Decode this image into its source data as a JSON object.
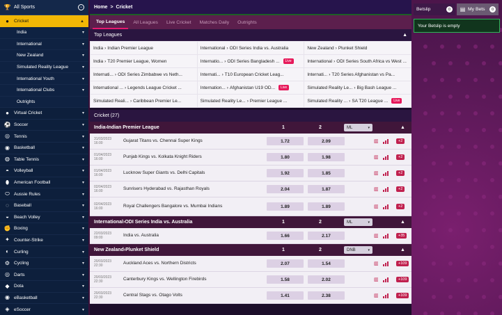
{
  "sidebar": {
    "all_sports": "All Sports",
    "cricket": "Cricket",
    "cricket_sub": [
      "India",
      "International",
      "New Zealand",
      "Simulated Reality League",
      "International Youth",
      "International Clubs",
      "Outrights"
    ],
    "sports": [
      {
        "label": "Virtual Cricket",
        "icon": "cricket-ball-icon"
      },
      {
        "label": "Soccer",
        "icon": "soccer-icon"
      },
      {
        "label": "Tennis",
        "icon": "tennis-icon"
      },
      {
        "label": "Basketball",
        "icon": "basketball-icon"
      },
      {
        "label": "Table Tennis",
        "icon": "table-tennis-icon"
      },
      {
        "label": "Volleyball",
        "icon": "volleyball-icon"
      },
      {
        "label": "American Football",
        "icon": "american-football-icon"
      },
      {
        "label": "Aussie Rules",
        "icon": "aussie-rules-icon"
      },
      {
        "label": "Baseball",
        "icon": "baseball-icon"
      },
      {
        "label": "Beach Volley",
        "icon": "beach-volley-icon"
      },
      {
        "label": "Boxing",
        "icon": "boxing-icon"
      },
      {
        "label": "Counter-Strike",
        "icon": "counter-strike-icon"
      },
      {
        "label": "Curling",
        "icon": "curling-icon"
      },
      {
        "label": "Cycling",
        "icon": "cycling-icon"
      },
      {
        "label": "Darts",
        "icon": "darts-icon"
      },
      {
        "label": "Dota",
        "icon": "dota-icon"
      },
      {
        "label": "eBasketball",
        "icon": "ebasketball-icon"
      },
      {
        "label": "eSoccer",
        "icon": "esoccer-icon"
      }
    ]
  },
  "breadcrumb": {
    "home": "Home",
    "sep": ">",
    "current": "Cricket"
  },
  "tabs": [
    "Top Leagues",
    "All Leagues",
    "Live Cricket",
    "Matches Daily",
    "Outrights"
  ],
  "top_leagues": {
    "title": "Top Leagues",
    "cells": [
      {
        "a": "India",
        "b": "Indian Premier League",
        "live": false
      },
      {
        "a": "International",
        "b": "ODI Series India vs. Australia",
        "live": false
      },
      {
        "a": "New Zealand",
        "b": "Plunket Shield",
        "live": false
      },
      {
        "a": "India",
        "b": "T20 Premier League, Women",
        "live": false
      },
      {
        "a": "Internatio...",
        "b": "ODI Series Bangladesh ...",
        "live": true
      },
      {
        "a": "International",
        "b": "ODI Series South Africa vs West ...",
        "live": false
      },
      {
        "a": "Internati...",
        "b": "ODI Series Zimbabwe vs Neth...",
        "live": false
      },
      {
        "a": "Internati...",
        "b": "T10 European Cricket Leag...",
        "live": false
      },
      {
        "a": "Internati...",
        "b": "T20 Series Afghanistan vs Pa...",
        "live": false
      },
      {
        "a": "International ...",
        "b": "Legends League Cricket ...",
        "live": false
      },
      {
        "a": "Internation...",
        "b": "Afghanistan U19 OD...",
        "live": true
      },
      {
        "a": "Simulated Reality Le...",
        "b": "Big Bash League ...",
        "live": false
      },
      {
        "a": "Simulated Reali...",
        "b": "Caribbean Premier Le...",
        "live": false
      },
      {
        "a": "Simulated Reality Le...",
        "b": "Premier League ...",
        "live": false
      },
      {
        "a": "Simulated Reality ...",
        "b": "SA T20 League ...",
        "live": true
      }
    ],
    "live_label": "Live"
  },
  "cricket_count": "Cricket (27)",
  "groups": [
    {
      "a": "India",
      "b": "Indian Premier League",
      "c1": "1",
      "c2": "2",
      "select": "ML",
      "events": [
        {
          "date": "31/03/2023",
          "time": "16:00",
          "teams": "Gujarat Titans vs. Chennai Super Kings",
          "o1": "1.72",
          "o2": "2.09",
          "more": "+2"
        },
        {
          "date": "01/04/2023",
          "time": "16:00",
          "teams": "Punjab Kings vs. Kolkata Knight Riders",
          "o1": "1.80",
          "o2": "1.98",
          "more": "+2"
        },
        {
          "date": "01/04/2023",
          "time": "16:00",
          "teams": "Lucknow Super Giants vs. Delhi Capitals",
          "o1": "1.92",
          "o2": "1.85",
          "more": "+2"
        },
        {
          "date": "02/04/2023",
          "time": "16:00",
          "teams": "Sunrisers Hyderabad vs. Rajasthan Royals",
          "o1": "2.04",
          "o2": "1.87",
          "more": "+2"
        },
        {
          "date": "02/04/2023",
          "time": "16:00",
          "teams": "Royal Challengers Bangalore vs. Mumbai Indians",
          "o1": "1.89",
          "o2": "1.89",
          "more": "+2",
          "tall": true
        }
      ]
    },
    {
      "a": "International",
      "b": "ODI Series India vs. Australia",
      "c1": "1",
      "c2": "2",
      "select": "ML",
      "events": [
        {
          "date": "22/03/2023",
          "time": "09:00",
          "teams": "India vs. Australia",
          "o1": "1.66",
          "o2": "2.17",
          "more": "+35"
        }
      ]
    },
    {
      "a": "New Zealand",
      "b": "Plunket Shield",
      "c1": "1",
      "c2": "2",
      "select": "DNB",
      "events": [
        {
          "date": "20/03/2023",
          "time": "22:30",
          "teams": "Auckland Aces vs. Northern Districts",
          "o1": "2.07",
          "o2": "1.54",
          "more": "+109"
        },
        {
          "date": "20/03/2023",
          "time": "22:30",
          "teams": "Canterbury Kings vs. Wellington Firebirds",
          "o1": "1.58",
          "o2": "2.02",
          "more": "+109"
        },
        {
          "date": "20/03/2023",
          "time": "22:30",
          "teams": "Central Stags vs. Otago Volts",
          "o1": "1.41",
          "o2": "2.38",
          "more": "+109"
        }
      ]
    }
  ],
  "betslip": {
    "tab1": "Betslip",
    "tab1_count": "0",
    "tab2": "My Bets",
    "tab2_count": "0",
    "empty": "Your Betslip is empty"
  },
  "colors": {
    "accent": "#f2b705",
    "live": "#e6195a",
    "brand": "#5c1f4d"
  }
}
